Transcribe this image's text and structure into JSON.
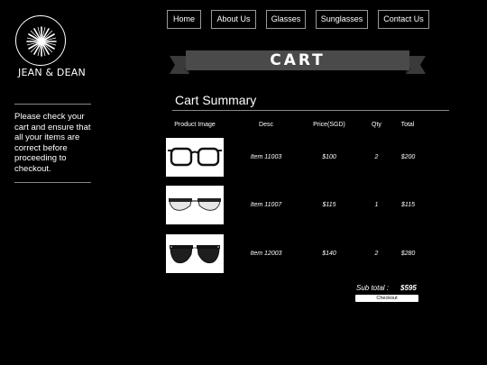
{
  "brand": {
    "name": "JEAN & DEAN",
    "logo_icon": "sunburst-logo-icon"
  },
  "sidebar": {
    "message": "Please check your cart and ensure that all your items are correct before proceeding to checkout."
  },
  "nav": {
    "items": [
      {
        "label": "Home"
      },
      {
        "label": "About Us"
      },
      {
        "label": "Glasses"
      },
      {
        "label": "Sunglasses"
      },
      {
        "label": "Contact Us"
      }
    ]
  },
  "banner": {
    "title": "CART"
  },
  "summary": {
    "title": "Cart Summary",
    "columns": [
      "Product Image",
      "Desc",
      "Price(SGD)",
      "Qty",
      "Total"
    ],
    "rows": [
      {
        "image": "black-eyeglasses-icon",
        "desc": "Item 11003",
        "price": "$100",
        "qty": "2",
        "total": "$200"
      },
      {
        "image": "clubmaster-eyeglasses-icon",
        "desc": "Item 11007",
        "price": "$115",
        "qty": "1",
        "total": "$115"
      },
      {
        "image": "clubmaster-sunglasses-icon",
        "desc": "Item 12003",
        "price": "$140",
        "qty": "2",
        "total": "$280"
      }
    ],
    "subtotal_label": "Sub total :",
    "subtotal_value": "$595",
    "checkout_label": "Checkout"
  },
  "colors": {
    "background": "#000000",
    "banner": "#3a3a3a",
    "text": "#ffffff"
  }
}
